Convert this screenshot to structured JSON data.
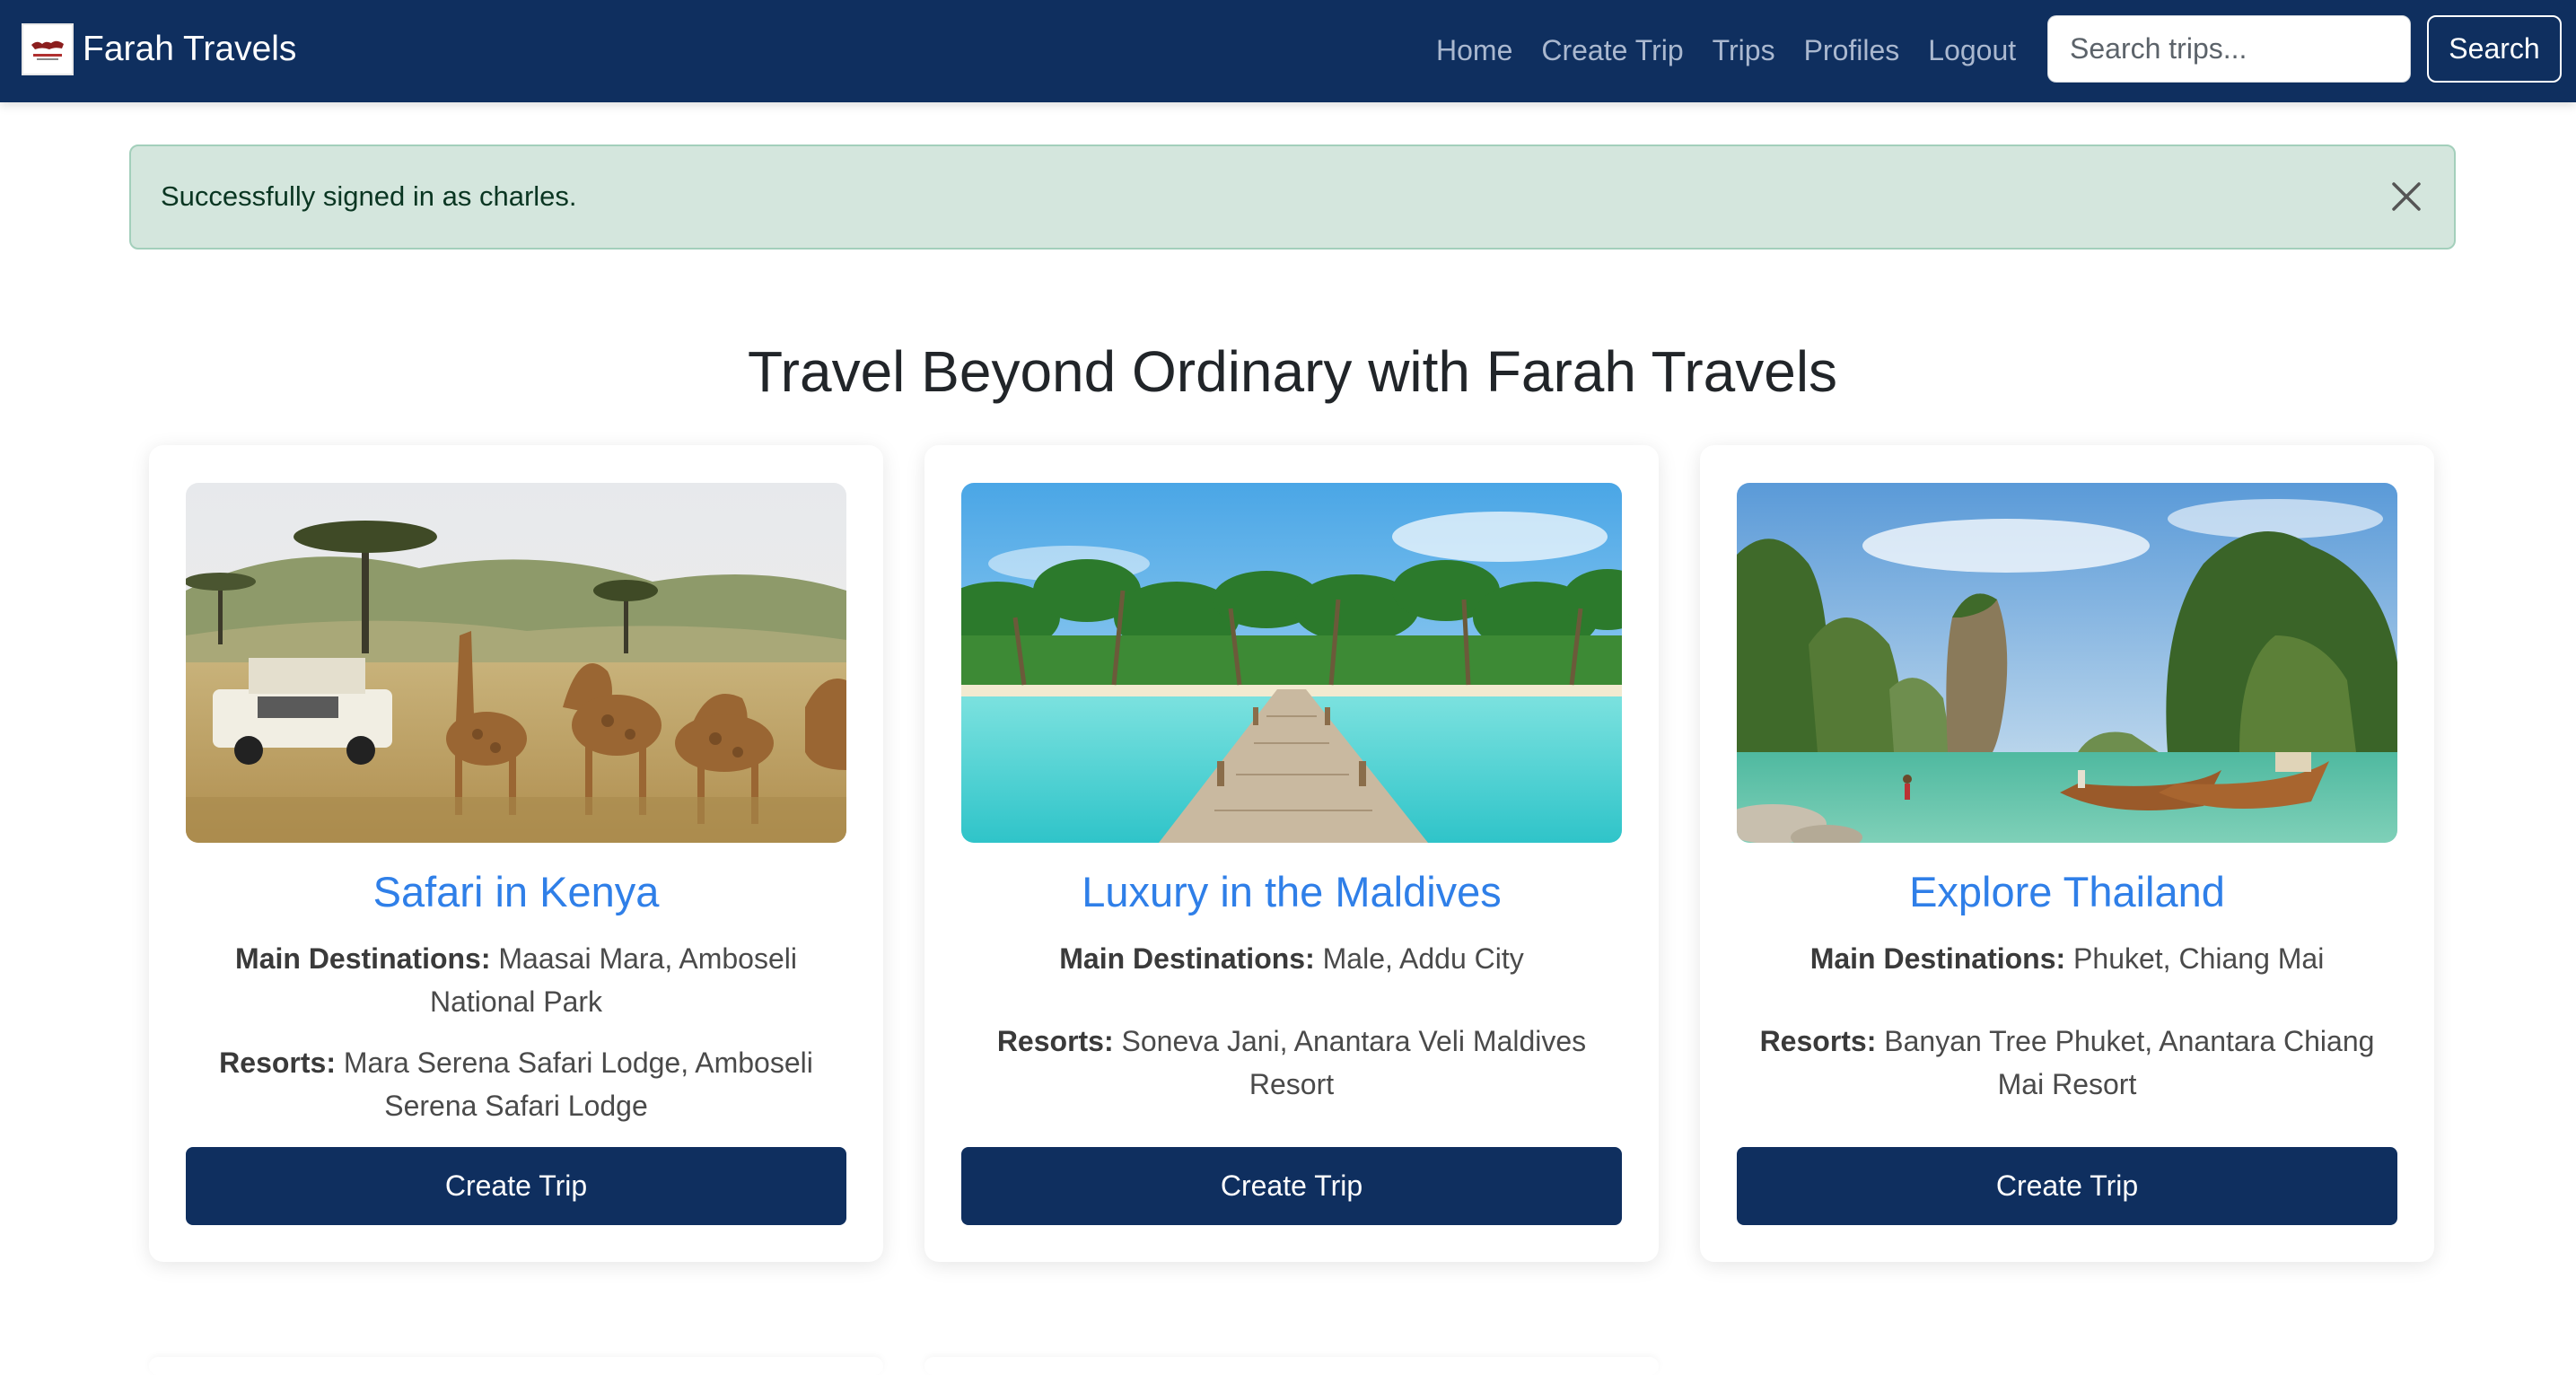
{
  "navbar": {
    "brand": "Farah Travels",
    "links": [
      "Home",
      "Create Trip",
      "Trips",
      "Profiles",
      "Logout"
    ],
    "search_placeholder": "Search trips...",
    "search_button": "Search"
  },
  "alert": {
    "message": "Successfully signed in as charles."
  },
  "page": {
    "title": "Travel Beyond Ordinary with Farah Travels"
  },
  "cards": [
    {
      "title": "Safari in Kenya",
      "destinations_label": "Main Destinations:",
      "destinations": "Maasai Mara, Amboseli National Park",
      "resorts_label": "Resorts:",
      "resorts": "Mara Serena Safari Lodge, Amboseli Serena Safari Lodge",
      "button": "Create Trip",
      "image": "kenya-safari-giraffes"
    },
    {
      "title": "Luxury in the Maldives",
      "destinations_label": "Main Destinations:",
      "destinations": "Male, Addu City",
      "resorts_label": "Resorts:",
      "resorts": "Soneva Jani, Anantara Veli Maldives Resort",
      "button": "Create Trip",
      "image": "maldives-beach-pier"
    },
    {
      "title": "Explore Thailand",
      "destinations_label": "Main Destinations:",
      "destinations": "Phuket, Chiang Mai",
      "resorts_label": "Resorts:",
      "resorts": "Banyan Tree Phuket, Anantara Chiang Mai Resort",
      "button": "Create Trip",
      "image": "thailand-limestone-islands"
    }
  ],
  "colors": {
    "navbar": "#0f2f5f",
    "accent_link": "#2f7fe8",
    "alert_bg": "#d4e6dd"
  }
}
